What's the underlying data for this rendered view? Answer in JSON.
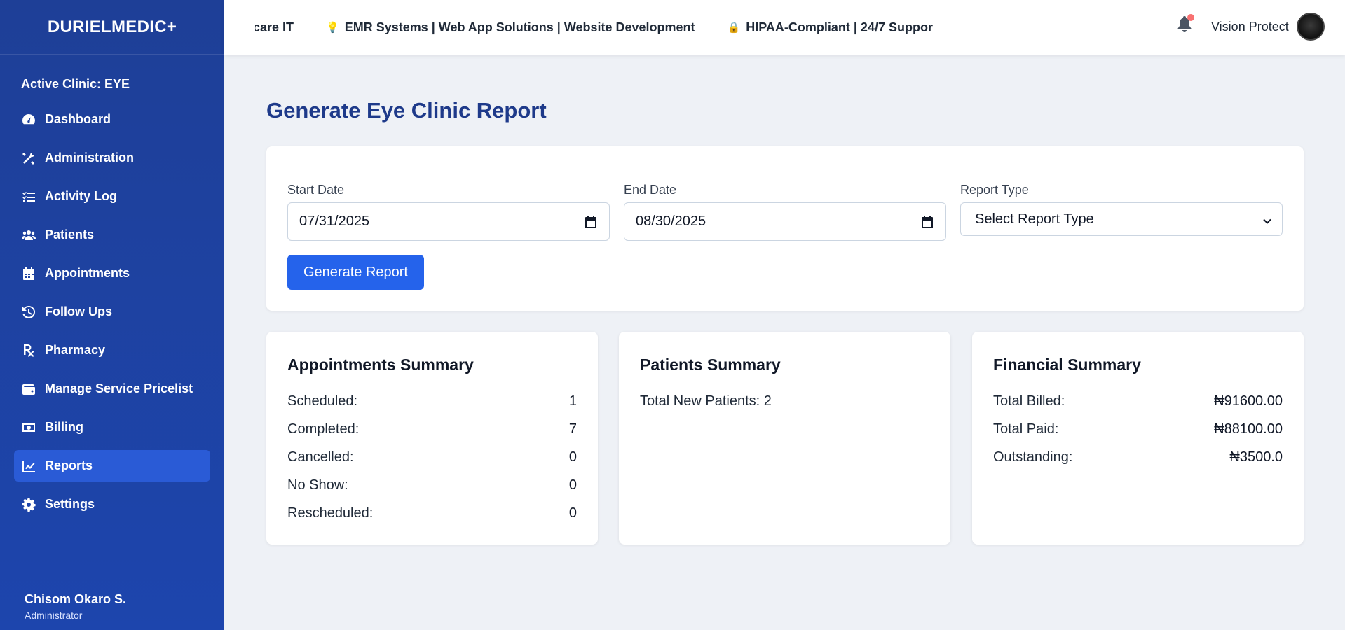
{
  "brand": "DURIELMEDIC+",
  "active_clinic": "Active Clinic: EYE",
  "sidebar": {
    "items": [
      {
        "label": "Dashboard",
        "icon": "tachometer-icon"
      },
      {
        "label": "Administration",
        "icon": "tools-icon"
      },
      {
        "label": "Activity Log",
        "icon": "list-check-icon"
      },
      {
        "label": "Patients",
        "icon": "users-icon"
      },
      {
        "label": "Appointments",
        "icon": "calendar-icon"
      },
      {
        "label": "Follow Ups",
        "icon": "history-icon"
      },
      {
        "label": "Pharmacy",
        "icon": "prescription-icon"
      },
      {
        "label": "Manage Service Pricelist",
        "icon": "wallet-icon"
      },
      {
        "label": "Billing",
        "icon": "money-bill-icon"
      },
      {
        "label": "Reports",
        "icon": "chart-line-icon",
        "active": true
      },
      {
        "label": "Settings",
        "icon": "gear-icon"
      }
    ]
  },
  "user": {
    "name": "Chisom Okaro S.",
    "role": "Administrator"
  },
  "topbar": {
    "ticker": [
      {
        "emoji": "",
        "text": "ncare IT"
      },
      {
        "emoji": "💡",
        "text": "EMR Systems | Web App Solutions | Website Development"
      },
      {
        "emoji": "🔒",
        "text": "HIPAA-Compliant | 24/7 Suppor"
      }
    ],
    "org_name": "Vision Protect",
    "notification_dot_color": "#f87171"
  },
  "page": {
    "title": "Generate Eye Clinic Report"
  },
  "filters": {
    "start_label": "Start Date",
    "start_value": "07/31/2025",
    "end_label": "End Date",
    "end_value": "08/30/2025",
    "type_label": "Report Type",
    "type_value": "Select Report Type",
    "generate_label": "Generate Report"
  },
  "appointments": {
    "title": "Appointments Summary",
    "rows": [
      {
        "label": "Scheduled:",
        "value": "1"
      },
      {
        "label": "Completed:",
        "value": "7"
      },
      {
        "label": "Cancelled:",
        "value": "0"
      },
      {
        "label": "No Show:",
        "value": "0"
      },
      {
        "label": "Rescheduled:",
        "value": "0"
      }
    ]
  },
  "patients": {
    "title": "Patients Summary",
    "total_new": "Total New Patients: 2"
  },
  "financial": {
    "title": "Financial Summary",
    "rows": [
      {
        "label": "Total Billed:",
        "value": "₦91600.00"
      },
      {
        "label": "Total Paid:",
        "value": "₦88100.00"
      },
      {
        "label": "Outstanding:",
        "value": "₦3500.0"
      }
    ]
  },
  "colors": {
    "sidebar": "#1e3f97",
    "accent": "#2563eb",
    "title": "#1e3a8a"
  }
}
